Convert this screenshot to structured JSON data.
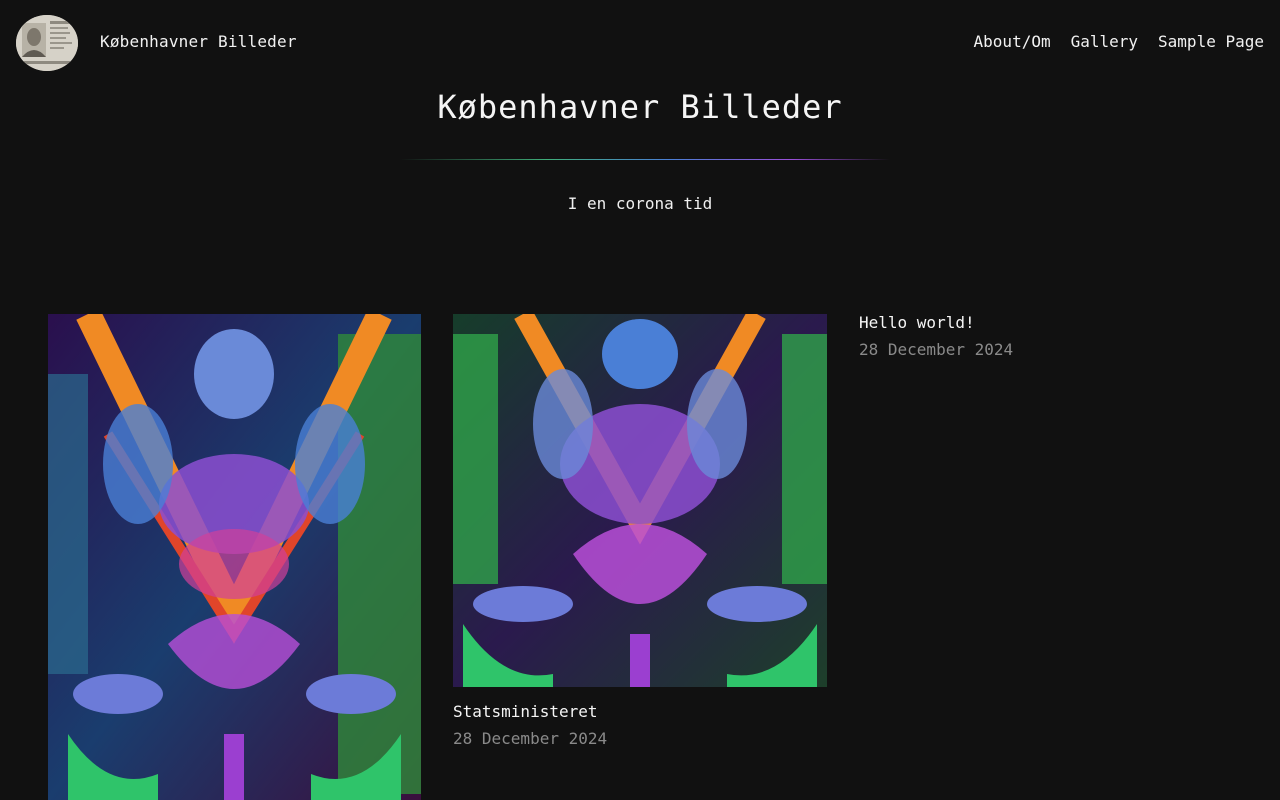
{
  "site": {
    "name": "Københavner Billeder",
    "avatar_icon": "portrait-avatar"
  },
  "nav": {
    "items": [
      {
        "label": "About/Om"
      },
      {
        "label": "Gallery"
      },
      {
        "label": "Sample Page"
      }
    ]
  },
  "hero": {
    "title": "Københavner Billeder",
    "tagline": "I en corona tid"
  },
  "posts": [
    {
      "title": "",
      "date": "",
      "image": "psychedelic-symmetric-artwork"
    },
    {
      "title": "Statsministeret",
      "date": "28 December 2024",
      "image": "psychedelic-symmetric-artwork"
    },
    {
      "title": "Hello world!",
      "date": "28 December 2024"
    }
  ],
  "colors": {
    "background": "#111111",
    "text": "#f5f5f5",
    "muted": "#8a8a8a"
  }
}
